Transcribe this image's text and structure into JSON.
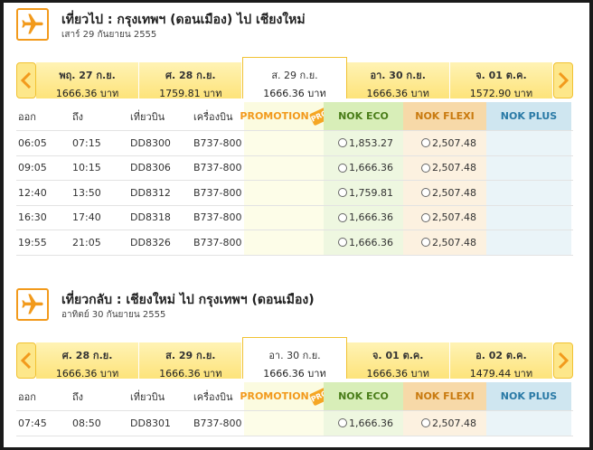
{
  "colors": {
    "accent": "#f29a1c",
    "eco": "#4a7d19",
    "flexi": "#c97a0f",
    "plus": "#2a7aa6"
  },
  "outbound": {
    "title": "เที่ยวไป  :  กรุงเทพฯ (ดอนเมือง)  ไป  เชียงใหม่",
    "subtitle": "เสาร์ 29 กันยายน 2555",
    "icon": "airplane-icon",
    "dates": [
      {
        "day": "พฤ. 27 ก.ย.",
        "price": "1666.36 บาท"
      },
      {
        "day": "ศ. 28 ก.ย.",
        "price": "1759.81 บาท"
      },
      {
        "day": "ส. 29 ก.ย.",
        "price": "1666.36 บาท"
      },
      {
        "day": "อา. 30 ก.ย.",
        "price": "1666.36 บาท"
      },
      {
        "day": "จ. 01 ต.ค.",
        "price": "1572.90 บาท"
      }
    ],
    "selected_index": 2,
    "headers": {
      "dep": "ออก",
      "arr": "ถึง",
      "flight": "เที่ยวบิน",
      "aircraft": "เครื่องบิน",
      "promo": "PROMOTION",
      "promo_tag": "PRO",
      "eco": "NOK ECO",
      "flexi": "NOK FLEXI",
      "plus": "NOK PLUS"
    },
    "flights": [
      {
        "dep": "06:05",
        "arr": "07:15",
        "flight": "DD8300",
        "aircraft": "B737-800",
        "eco": "1,853.27",
        "flexi": "2,507.48"
      },
      {
        "dep": "09:05",
        "arr": "10:15",
        "flight": "DD8306",
        "aircraft": "B737-800",
        "eco": "1,666.36",
        "flexi": "2,507.48"
      },
      {
        "dep": "12:40",
        "arr": "13:50",
        "flight": "DD8312",
        "aircraft": "B737-800",
        "eco": "1,759.81",
        "flexi": "2,507.48"
      },
      {
        "dep": "16:30",
        "arr": "17:40",
        "flight": "DD8318",
        "aircraft": "B737-800",
        "eco": "1,666.36",
        "flexi": "2,507.48"
      },
      {
        "dep": "19:55",
        "arr": "21:05",
        "flight": "DD8326",
        "aircraft": "B737-800",
        "eco": "1,666.36",
        "flexi": "2,507.48"
      }
    ]
  },
  "return": {
    "title": "เที่ยวกลับ  :  เชียงใหม่  ไป  กรุงเทพฯ (ดอนเมือง)",
    "subtitle": "อาทิตย์ 30 กันยายน 2555",
    "icon": "airplane-icon",
    "dates": [
      {
        "day": "ศ. 28 ก.ย.",
        "price": "1666.36 บาท"
      },
      {
        "day": "ส. 29 ก.ย.",
        "price": "1666.36 บาท"
      },
      {
        "day": "อา. 30 ก.ย.",
        "price": "1666.36 บาท"
      },
      {
        "day": "จ. 01 ต.ค.",
        "price": "1666.36 บาท"
      },
      {
        "day": "อ. 02 ต.ค.",
        "price": "1479.44 บาท"
      }
    ],
    "selected_index": 2,
    "headers": {
      "dep": "ออก",
      "arr": "ถึง",
      "flight": "เที่ยวบิน",
      "aircraft": "เครื่องบิน",
      "promo": "PROMOTION",
      "promo_tag": "PRO",
      "eco": "NOK ECO",
      "flexi": "NOK FLEXI",
      "plus": "NOK PLUS"
    },
    "flights": [
      {
        "dep": "07:45",
        "arr": "08:50",
        "flight": "DD8301",
        "aircraft": "B737-800",
        "eco": "1,666.36",
        "flexi": "2,507.48"
      }
    ]
  }
}
